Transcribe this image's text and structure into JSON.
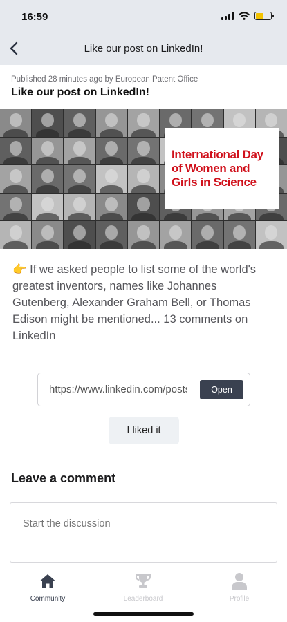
{
  "status_bar": {
    "time": "16:59",
    "battery_level": 0.5
  },
  "nav": {
    "title": "Like our post on LinkedIn!"
  },
  "post": {
    "published": "Published 28 minutes ago by European Patent Office",
    "title": "Like our post on LinkedIn!",
    "image_caption": "International Day\nof Women and\nGirls in Science",
    "body": "👉 If we asked people to list some of the world's greatest inventors, names like Johannes Gutenberg, Alexander Graham Bell, or Thomas Edison might be mentioned... 13 comments on LinkedIn"
  },
  "link": {
    "url": "https://www.linkedin.com/posts",
    "open_label": "Open"
  },
  "liked_label": "I liked it",
  "comments": {
    "heading": "Leave a comment",
    "placeholder": "Start the discussion"
  },
  "tabs": [
    {
      "label": "Community",
      "icon": "home-icon",
      "active": true
    },
    {
      "label": "Leaderboard",
      "icon": "trophy-icon",
      "active": false
    },
    {
      "label": "Profile",
      "icon": "person-icon",
      "active": false
    }
  ],
  "colors": {
    "accent": "#3a4150",
    "headline_red": "#d0101b",
    "nav_bg": "#e6e9ee"
  }
}
